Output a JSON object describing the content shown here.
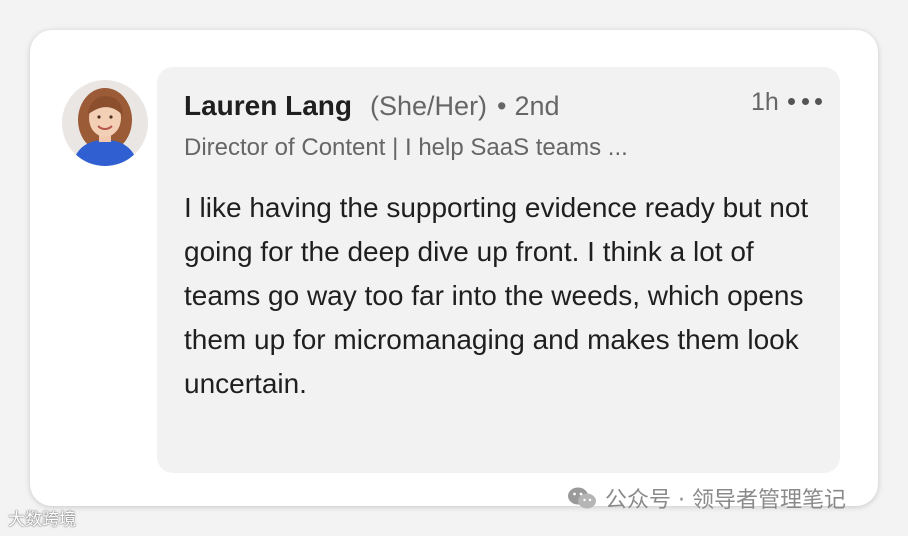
{
  "comment": {
    "author_name": "Lauren Lang",
    "pronouns": "(She/Her)",
    "separator": "•",
    "connection_degree": "2nd",
    "headline": "Director of Content | I help SaaS teams ...",
    "timestamp": "1h",
    "more_icon": "more-horizontal-icon",
    "body": "I like having the supporting evidence ready but not going for the deep dive up front. I think a lot of teams go way too far into the weeds, which opens them up for micromanaging and makes them look uncertain."
  },
  "watermarks": {
    "right": "公众号 · 领导者管理笔记",
    "right_icon": "wechat-icon",
    "left": "大数跨境"
  },
  "colors": {
    "page_bg": "#f3f3f3",
    "card_bg": "#ffffff",
    "bubble_bg": "#f2f2f2",
    "text_primary": "#1f1f1f",
    "text_secondary": "#666666"
  }
}
